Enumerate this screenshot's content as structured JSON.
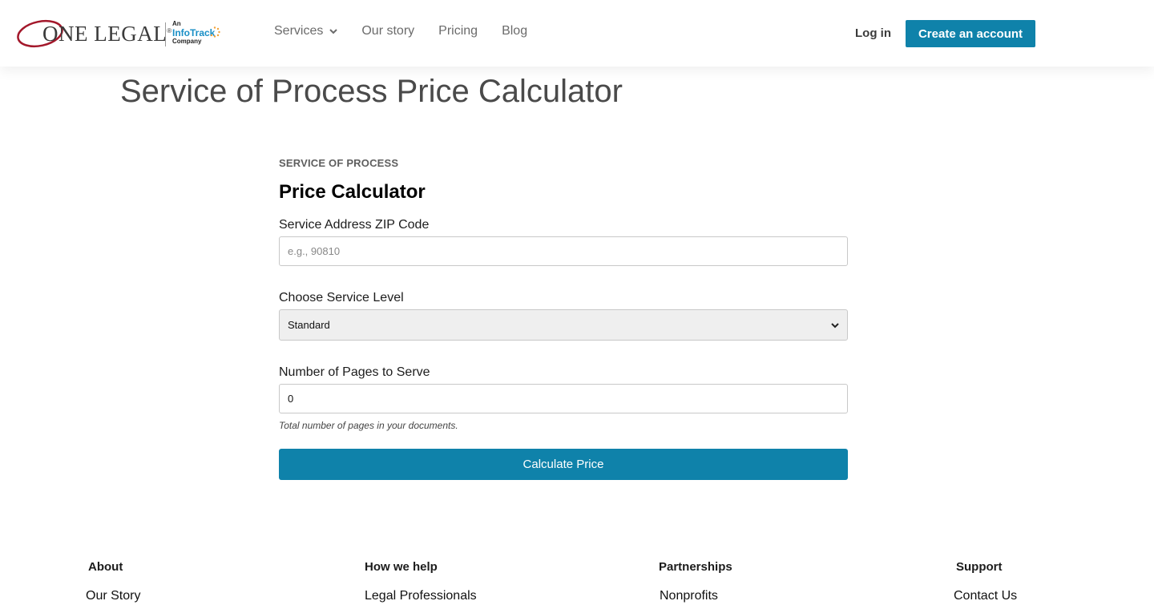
{
  "header": {
    "logo": {
      "brand": "ONE LEGAL",
      "registered": "®",
      "partner_prefix": "An",
      "partner_name": "InfoTrack",
      "partner_suffix": "Company",
      "ring_color": "#a3182b"
    },
    "nav": [
      {
        "label": "Services",
        "has_dropdown": true
      },
      {
        "label": "Our story"
      },
      {
        "label": "Pricing"
      },
      {
        "label": "Blog"
      }
    ],
    "login_label": "Log in",
    "create_account_label": "Create an account"
  },
  "page": {
    "title": "Service of Process Price Calculator"
  },
  "form": {
    "eyebrow": "SERVICE OF PROCESS",
    "title": "Price Calculator",
    "zip": {
      "label": "Service Address ZIP Code",
      "placeholder": "e.g., 90810",
      "value": ""
    },
    "service_level": {
      "label": "Choose Service Level",
      "selected": "Standard"
    },
    "pages": {
      "label": "Number of Pages to Serve",
      "value": "0",
      "hint": "Total number of pages in your documents."
    },
    "submit_label": "Calculate Price"
  },
  "footer": {
    "columns": [
      {
        "heading": "About",
        "links": [
          "Our Story"
        ]
      },
      {
        "heading": "How we help",
        "links": [
          "Legal Professionals"
        ]
      },
      {
        "heading": "Partnerships",
        "links": [
          "Nonprofits"
        ]
      },
      {
        "heading": "Support",
        "links": [
          "Contact Us"
        ]
      }
    ]
  },
  "colors": {
    "accent": "#0f82aa",
    "brand_red": "#a3182b",
    "infotrack_blue": "#1a8fc6"
  }
}
